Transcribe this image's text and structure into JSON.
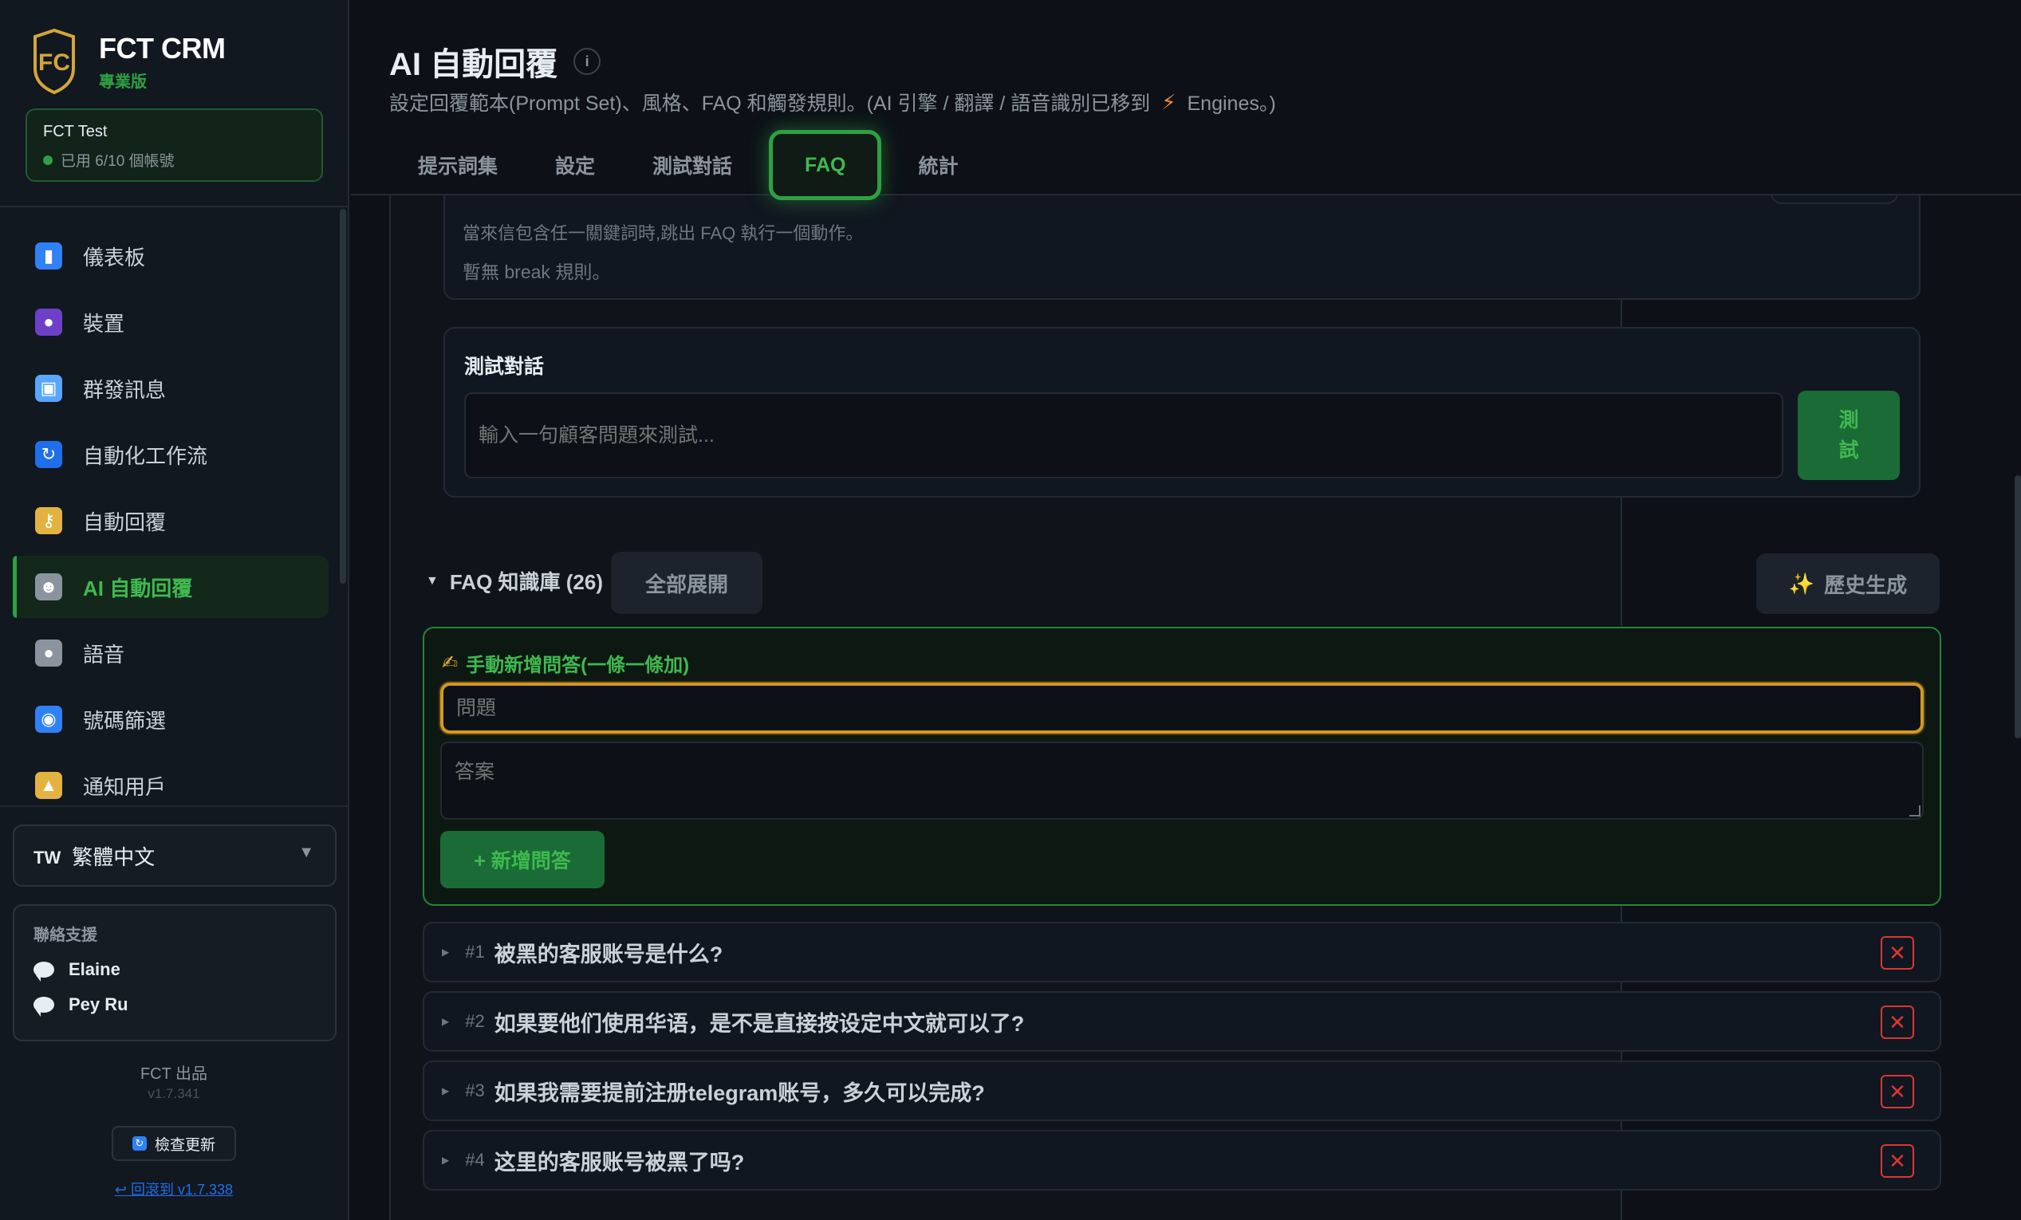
{
  "brand": {
    "title": "FCT CRM",
    "edition": "專業版",
    "logo_text": "FC"
  },
  "account": {
    "name": "FCT Test",
    "usage": "已用 6/10 個帳號"
  },
  "nav": {
    "items": [
      {
        "label": "儀表板",
        "icon": "chart-icon",
        "color": "#2f81f7"
      },
      {
        "label": "裝置",
        "icon": "user-icon",
        "color": "#6e40c9"
      },
      {
        "label": "群發訊息",
        "icon": "inbox-icon",
        "color": "#58a6ff"
      },
      {
        "label": "自動化工作流",
        "icon": "refresh-icon",
        "color": "#1f6feb"
      },
      {
        "label": "自動回覆",
        "icon": "key-icon",
        "color": "#e3b341"
      },
      {
        "label": "AI 自動回覆",
        "icon": "robot-icon",
        "color": "#8b949e"
      },
      {
        "label": "語音",
        "icon": "microphone-icon",
        "color": "#8b949e"
      },
      {
        "label": "號碼篩選",
        "icon": "search-icon",
        "color": "#2f81f7"
      },
      {
        "label": "通知用戶",
        "icon": "bell-icon",
        "color": "#e3b341"
      }
    ],
    "active_index": 5
  },
  "language": {
    "code": "TW",
    "label": "繁體中文"
  },
  "support": {
    "title": "聯絡支援",
    "contacts": [
      "Elaine",
      "Pey Ru"
    ]
  },
  "footer": {
    "made_by": "FCT 出品",
    "version": "v1.7.341",
    "check_update": "檢查更新",
    "rollback": "↩ 回滾到 v1.7.338"
  },
  "page": {
    "title": "AI 自動回覆",
    "desc_before": "設定回覆範本(Prompt Set)、風格、FAQ 和觸發規則。(AI 引擎 / 翻譯 / 語音識別已移到",
    "desc_after": "Engines。)",
    "tabs": [
      "提示詞集",
      "設定",
      "測試對話",
      "FAQ",
      "統計"
    ],
    "active_tab": 3
  },
  "break_rules": {
    "desc": "當來信包含任一關鍵詞時,跳出 FAQ 執行一個動作。",
    "empty": "暫無 break 規則。"
  },
  "test_dialog": {
    "title": "測試對話",
    "placeholder": "輸入一句顧客問題來測試...",
    "button": "測試"
  },
  "faq": {
    "heading": "FAQ 知識庫 (26)",
    "expand_all": "全部展開",
    "history_generate": "歷史生成",
    "manual_add_title": "手動新增問答(一條一條加)",
    "question_placeholder": "問題",
    "answer_placeholder": "答案",
    "add_button": "+ 新增問答",
    "items": [
      {
        "num": "#1",
        "question": "被黑的客服账号是什么?"
      },
      {
        "num": "#2",
        "question": "如果要他们使用华语，是不是直接按设定中文就可以了?"
      },
      {
        "num": "#3",
        "question": "如果我需要提前注册telegram账号，多久可以完成?"
      },
      {
        "num": "#4",
        "question": "这里的客服账号被黑了吗?"
      }
    ]
  }
}
